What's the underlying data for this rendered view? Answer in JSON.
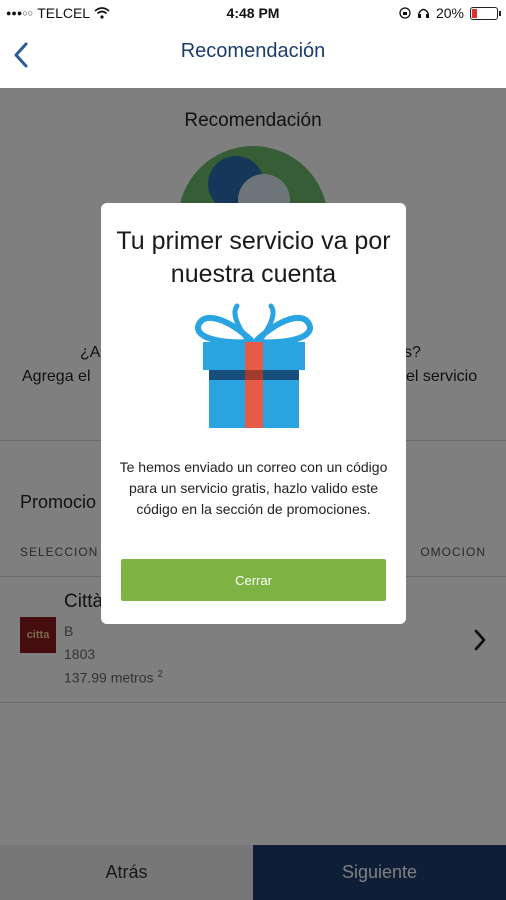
{
  "status_bar": {
    "carrier": "TELCEL",
    "time": "4:48 PM",
    "battery": "20%",
    "battery_level": 0.2
  },
  "nav": {
    "title": "Recomendación"
  },
  "recommendation": {
    "title": "Recomendación",
    "question_fragment_left": "¿Al",
    "question_fragment_right": "s?",
    "text_fragment_left": "Agrega el",
    "text_fragment_right": "el servicio"
  },
  "promotions": {
    "heading_fragment": "Promocio",
    "header_left_fragment": "SELECCION",
    "header_right_fragment": "OMOCION",
    "item": {
      "name_fragment": "Città",
      "logo_text": "citta",
      "line1": "B",
      "line2": "1803",
      "line3": "137.99 metros",
      "superscript": "2"
    }
  },
  "bottom_bar": {
    "back_label": "Atrás",
    "next_label": "Siguiente"
  },
  "modal": {
    "title": "Tu primer servicio va por nuestra cuenta",
    "message": "Te hemos enviado un correo con un código para un servicio gratis, hazlo valido este código en la sección de promociones.",
    "close_label": "Cerrar",
    "gift_icon": "gift-icon"
  },
  "colors": {
    "brand_navy": "#1b3d6d",
    "accent_green": "#7cb342",
    "gift_blue": "#29a4e0",
    "gift_ribbon": "#e65a48"
  }
}
